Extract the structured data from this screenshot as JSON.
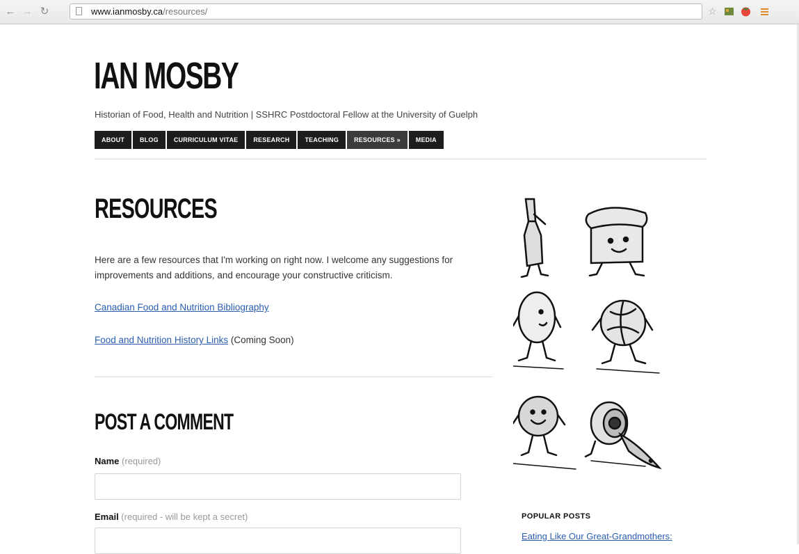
{
  "browser": {
    "url_host": "www.ianmosby.ca",
    "url_path": "/resources/"
  },
  "site": {
    "title": "IAN MOSBY",
    "tagline": "Historian of Food, Health and Nutrition | SSHRC Postdoctoral Fellow at the University of Guelph"
  },
  "nav": {
    "items": [
      "ABOUT",
      "BLOG",
      "CURRICULUM VITAE",
      "RESEARCH",
      "TEACHING",
      "RESOURCES »",
      "MEDIA"
    ]
  },
  "page": {
    "heading": "RESOURCES",
    "intro": "Here are a few resources that I'm working on right now. I welcome any suggestions for improvements and additions, and encourage your constructive criticism.",
    "link1": "Canadian Food and Nutrition Bibliography",
    "link2": "Food and Nutrition History Links",
    "link2_note": " (Coming Soon)"
  },
  "comment": {
    "heading": "POST A COMMENT",
    "name_label": "Name",
    "name_hint": " (required)",
    "email_label": "Email",
    "email_hint": " (required - will be kept a secret)"
  },
  "sidebar": {
    "heading": "POPULAR POSTS",
    "first_post": "Eating Like Our Great-Grandmothers:"
  }
}
